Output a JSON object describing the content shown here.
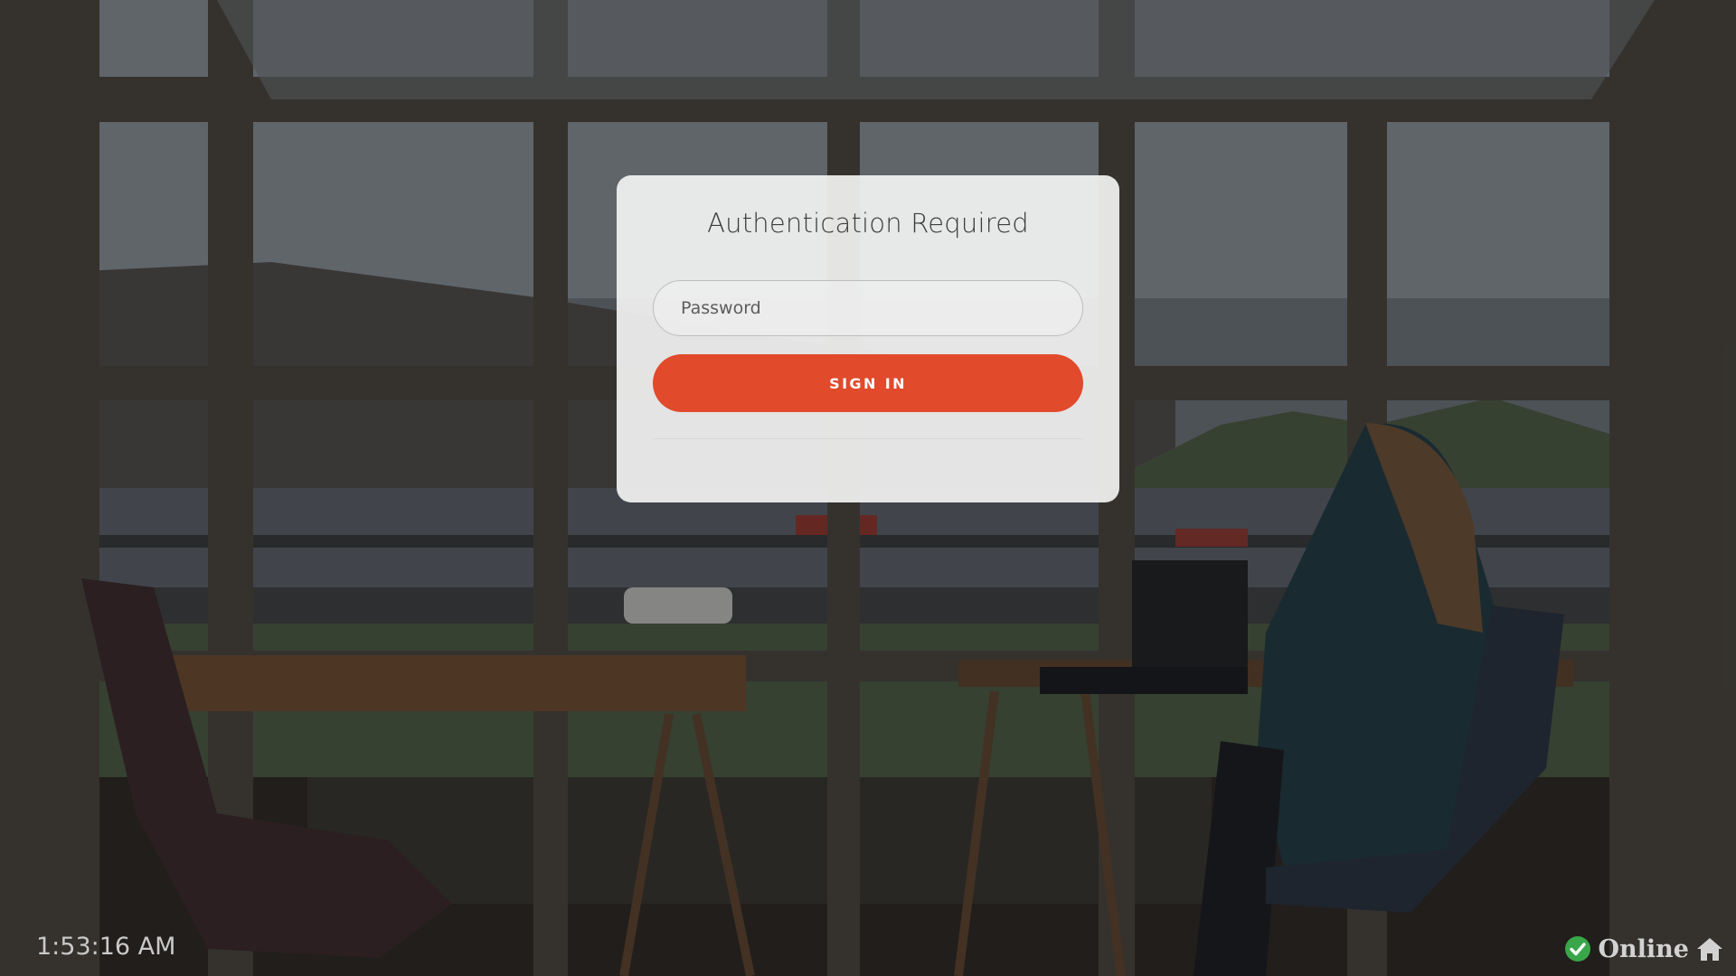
{
  "auth": {
    "title": "Authentication Required",
    "password_placeholder": "Password",
    "signin_label": "SIGN IN"
  },
  "footer": {
    "clock": "1:53:16 AM",
    "status": "Online",
    "status_icon": "check-circle-icon",
    "home_icon": "home-icon"
  },
  "colors": {
    "accent": "#e14a2b",
    "status_ok": "#3aa64a"
  }
}
